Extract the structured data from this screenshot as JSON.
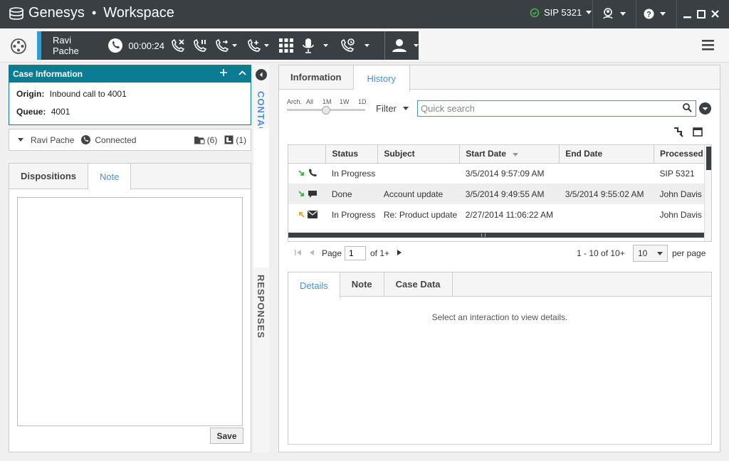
{
  "app": {
    "brand": "Genesys",
    "separator": "•",
    "product": "Workspace",
    "sip_status": "SIP 5321",
    "status_color": "#4caf50",
    "accent": "#0b7c93",
    "link_color": "#4a90d9"
  },
  "call": {
    "party": "Ravi Pache",
    "timer": "00:00:24"
  },
  "case_info": {
    "title": "Case Information",
    "origin_label": "Origin:",
    "origin_value": "Inbound call to 4001",
    "queue_label": "Queue:",
    "queue_value": "4001"
  },
  "party_row": {
    "name": "Ravi Pache",
    "state": "Connected",
    "cases_count": "(6)",
    "notes_count": "(1)"
  },
  "left_tabs": {
    "dispositions": "Dispositions",
    "note": "Note"
  },
  "note": {
    "value": "",
    "save_label": "Save"
  },
  "side": {
    "contact": "CONTACT",
    "responses": "RESPONSES"
  },
  "right_tabs": {
    "information": "Information",
    "history": "History"
  },
  "slider": {
    "labels": [
      "Arch.",
      "All",
      "1M",
      "1W",
      "1D"
    ]
  },
  "filter": {
    "label": "Filter",
    "search_placeholder": "Quick search"
  },
  "grid": {
    "columns": [
      "Status",
      "Subject",
      "Start Date",
      "End Date",
      "Processed"
    ],
    "rows": [
      {
        "status": "In Progress",
        "subject": "",
        "start": "3/5/2014 9:57:09 AM",
        "end": "",
        "processed": "SIP 5321",
        "media": "phone"
      },
      {
        "status": "Done",
        "subject": "Account update",
        "start": "3/5/2014 9:49:55 AM",
        "end": "3/5/2014 9:55:02 AM",
        "processed": "John Davis",
        "media": "chat"
      },
      {
        "status": "In Progress",
        "subject": "Re: Product update",
        "start": "2/27/2014 11:06:22 AM",
        "end": "",
        "processed": "John Davis",
        "media": "email"
      }
    ]
  },
  "pager": {
    "page_label": "Page",
    "page_value": "1",
    "of_label": "of 1+",
    "range": "1 - 10 of 10+",
    "per_page_value": "10",
    "per_page_label": "per page"
  },
  "details": {
    "tabs": [
      "Details",
      "Note",
      "Case Data"
    ],
    "empty_message": "Select an interaction to view details."
  }
}
